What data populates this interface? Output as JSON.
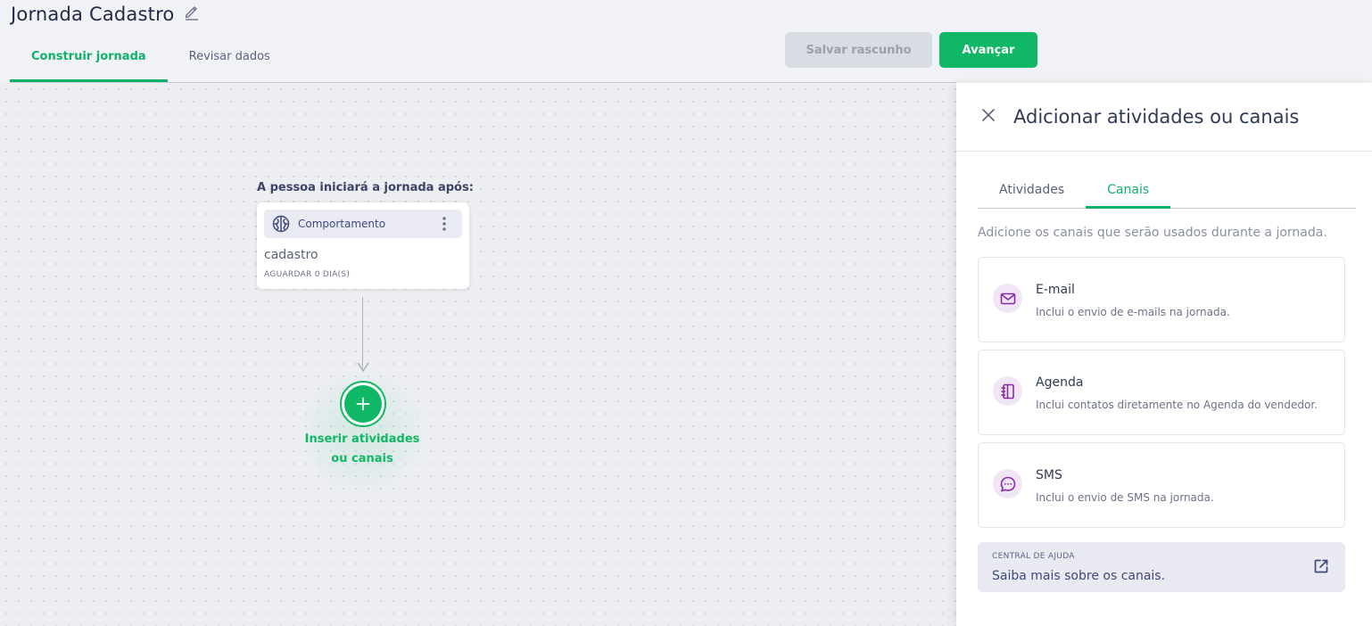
{
  "header": {
    "title": "Jornada Cadastro",
    "tabs": [
      {
        "label": "Construir jornada",
        "active": true
      },
      {
        "label": "Revisar dados",
        "active": false
      }
    ],
    "save_draft_label": "Salvar rascunho",
    "next_label": "Avançar"
  },
  "canvas": {
    "start_label": "A pessoa iniciará a jornada após:",
    "node": {
      "type_label": "Comportamento",
      "name": "cadastro",
      "wait": "AGUARDAR 0 DIA(S)"
    },
    "insert_label_line1": "Inserir atividades",
    "insert_label_line2": "ou canais"
  },
  "panel": {
    "title": "Adicionar atividades ou canais",
    "tabs": [
      {
        "label": "Atividades",
        "active": false
      },
      {
        "label": "Canais",
        "active": true
      }
    ],
    "description": "Adicione os canais que serão usados durante a jornada.",
    "channels": [
      {
        "name": "E-mail",
        "description": "Inclui o envio de e-mails na jornada.",
        "icon": "mail-icon"
      },
      {
        "name": "Agenda",
        "description": "Inclui contatos diretamente no Agenda do vendedor.",
        "icon": "notebook-icon"
      },
      {
        "name": "SMS",
        "description": "Inclui o envio de SMS na jornada.",
        "icon": "chat-icon"
      }
    ],
    "help": {
      "kicker": "CENTRAL DE AJUDA",
      "link": "Saiba mais sobre os canais."
    }
  },
  "colors": {
    "accent": "#10b865",
    "channel_icon": "#8a2aa8",
    "channel_icon_bg": "#f1e6f5"
  }
}
